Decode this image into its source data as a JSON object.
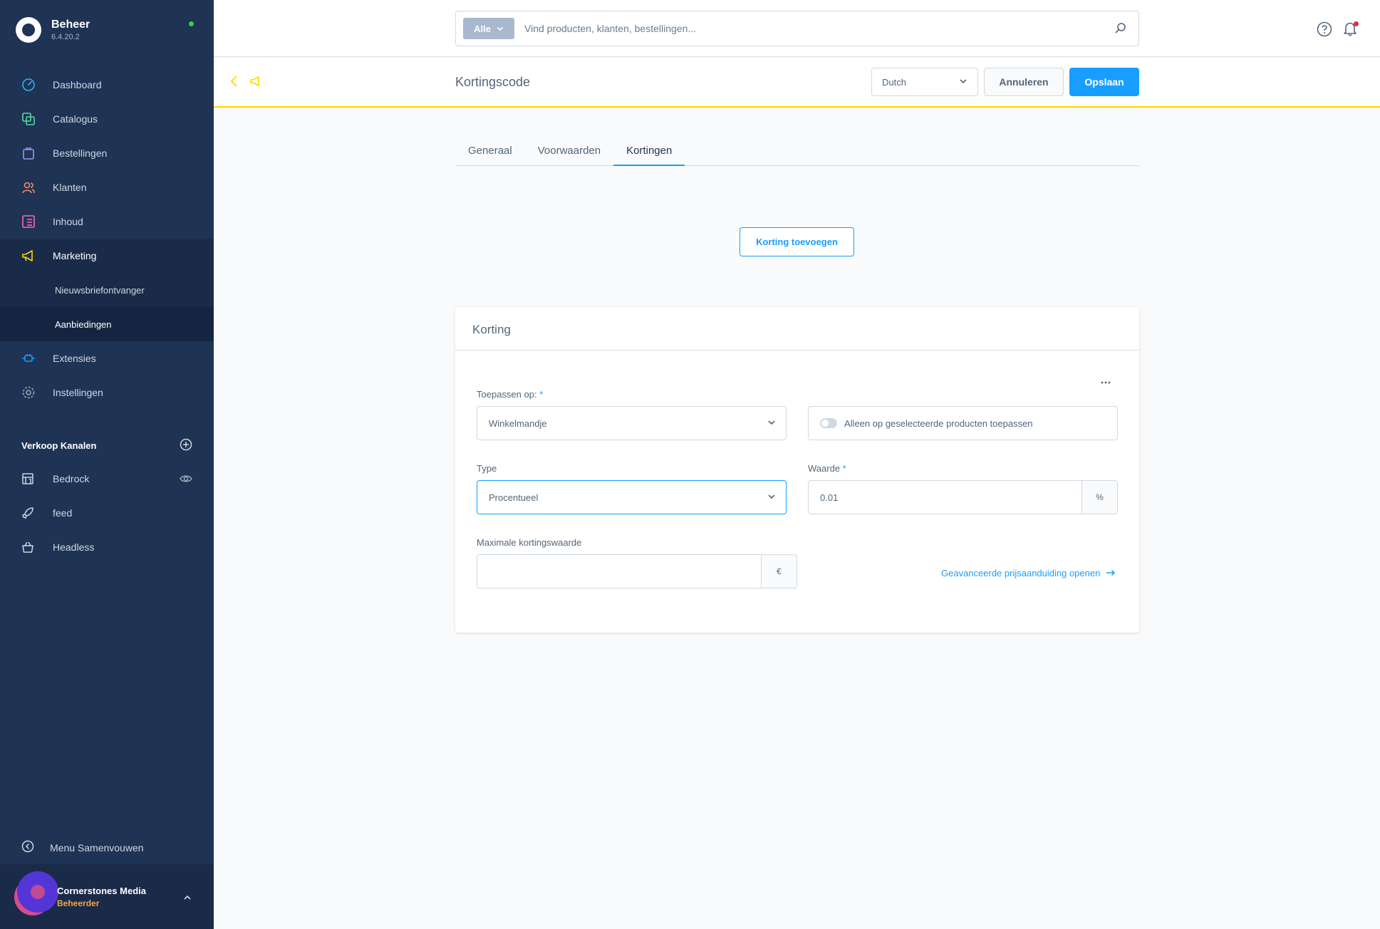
{
  "sidebar": {
    "brand": {
      "title": "Beheer",
      "version": "6.4.20.2"
    },
    "nav": [
      {
        "label": "Dashboard"
      },
      {
        "label": "Catalogus"
      },
      {
        "label": "Bestellingen"
      },
      {
        "label": "Klanten"
      },
      {
        "label": "Inhoud"
      },
      {
        "label": "Marketing"
      }
    ],
    "marketing_sub": [
      {
        "label": "Nieuwsbriefontvanger"
      },
      {
        "label": "Aanbiedingen"
      }
    ],
    "nav_bottom": [
      {
        "label": "Extensies"
      },
      {
        "label": "Instellingen"
      }
    ],
    "channels_title": "Verkoop Kanalen",
    "channels": [
      {
        "label": "Bedrock"
      },
      {
        "label": "feed"
      },
      {
        "label": "Headless"
      }
    ],
    "collapse_label": "Menu Samenvouwen",
    "user": {
      "name": "Cornerstones Media",
      "role": "Beheerder"
    }
  },
  "topbar": {
    "search_type": "Alle",
    "search_placeholder": "Vind producten, klanten, bestellingen..."
  },
  "header": {
    "title": "Kortingscode",
    "language": "Dutch",
    "cancel_label": "Annuleren",
    "save_label": "Opslaan"
  },
  "tabs": [
    {
      "label": "Generaal"
    },
    {
      "label": "Voorwaarden"
    },
    {
      "label": "Kortingen"
    }
  ],
  "add_discount_label": "Korting toevoegen",
  "card": {
    "title": "Korting",
    "apply_label": "Toepassen op:",
    "apply_value": "Winkelmandje",
    "toggle_label": "Alleen op geselecteerde producten toepassen",
    "type_label": "Type",
    "type_value": "Procentueel",
    "value_label": "Waarde",
    "value_value": "0.01",
    "value_suffix": "%",
    "max_label": "Maximale kortingswaarde",
    "max_value": "",
    "max_suffix": "€",
    "advanced_link": "Geavanceerde prijsaanduiding openen",
    "required_mark": "*"
  }
}
